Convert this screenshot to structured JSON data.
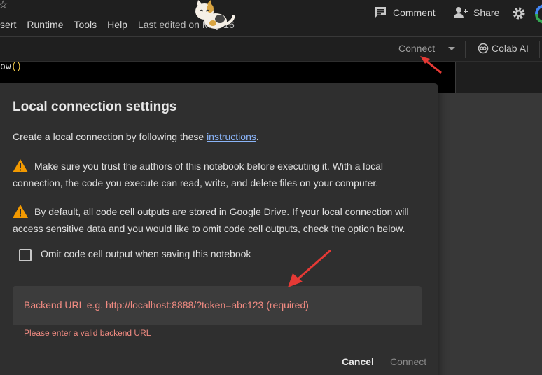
{
  "menu": {
    "items": [
      "sert",
      "Runtime",
      "Tools",
      "Help"
    ],
    "last_edited": "Last edited on May 16"
  },
  "header": {
    "comment_label": "Comment",
    "share_label": "Share"
  },
  "toolbar": {
    "connect_label": "Connect",
    "colab_ai_label": "Colab AI"
  },
  "code": {
    "text": "ow",
    "parens": "()"
  },
  "dialog": {
    "title": "Local connection settings",
    "intro_prefix": "Create a local connection by following these ",
    "intro_link": "instructions",
    "intro_suffix": ".",
    "warning1": "Make sure you trust the authors of this notebook before executing it. With a local connection, the code you execute can read, write, and delete files on your computer.",
    "warning2": "By default, all code cell outputs are stored in Google Drive. If your local connection will access sensitive data and you would like to omit code cell outputs, check the option below.",
    "checkbox_label": "Omit code cell output when saving this notebook",
    "checkbox_checked": false,
    "backend_placeholder": "Backend URL e.g. http://localhost:8888/?token=abc123 (required)",
    "error_text": "Please enter a valid backend URL",
    "cancel_label": "Cancel",
    "connect_label": "Connect"
  },
  "colors": {
    "error": "#f28b82",
    "link": "#8ab4f8",
    "warning": "#f29900",
    "annotation_arrow": "#e53935"
  },
  "icons": [
    "star-icon",
    "comment-icon",
    "share-icon",
    "settings-gear-icon",
    "colab-ai-icon",
    "warning-icon",
    "dropdown-caret-icon"
  ]
}
